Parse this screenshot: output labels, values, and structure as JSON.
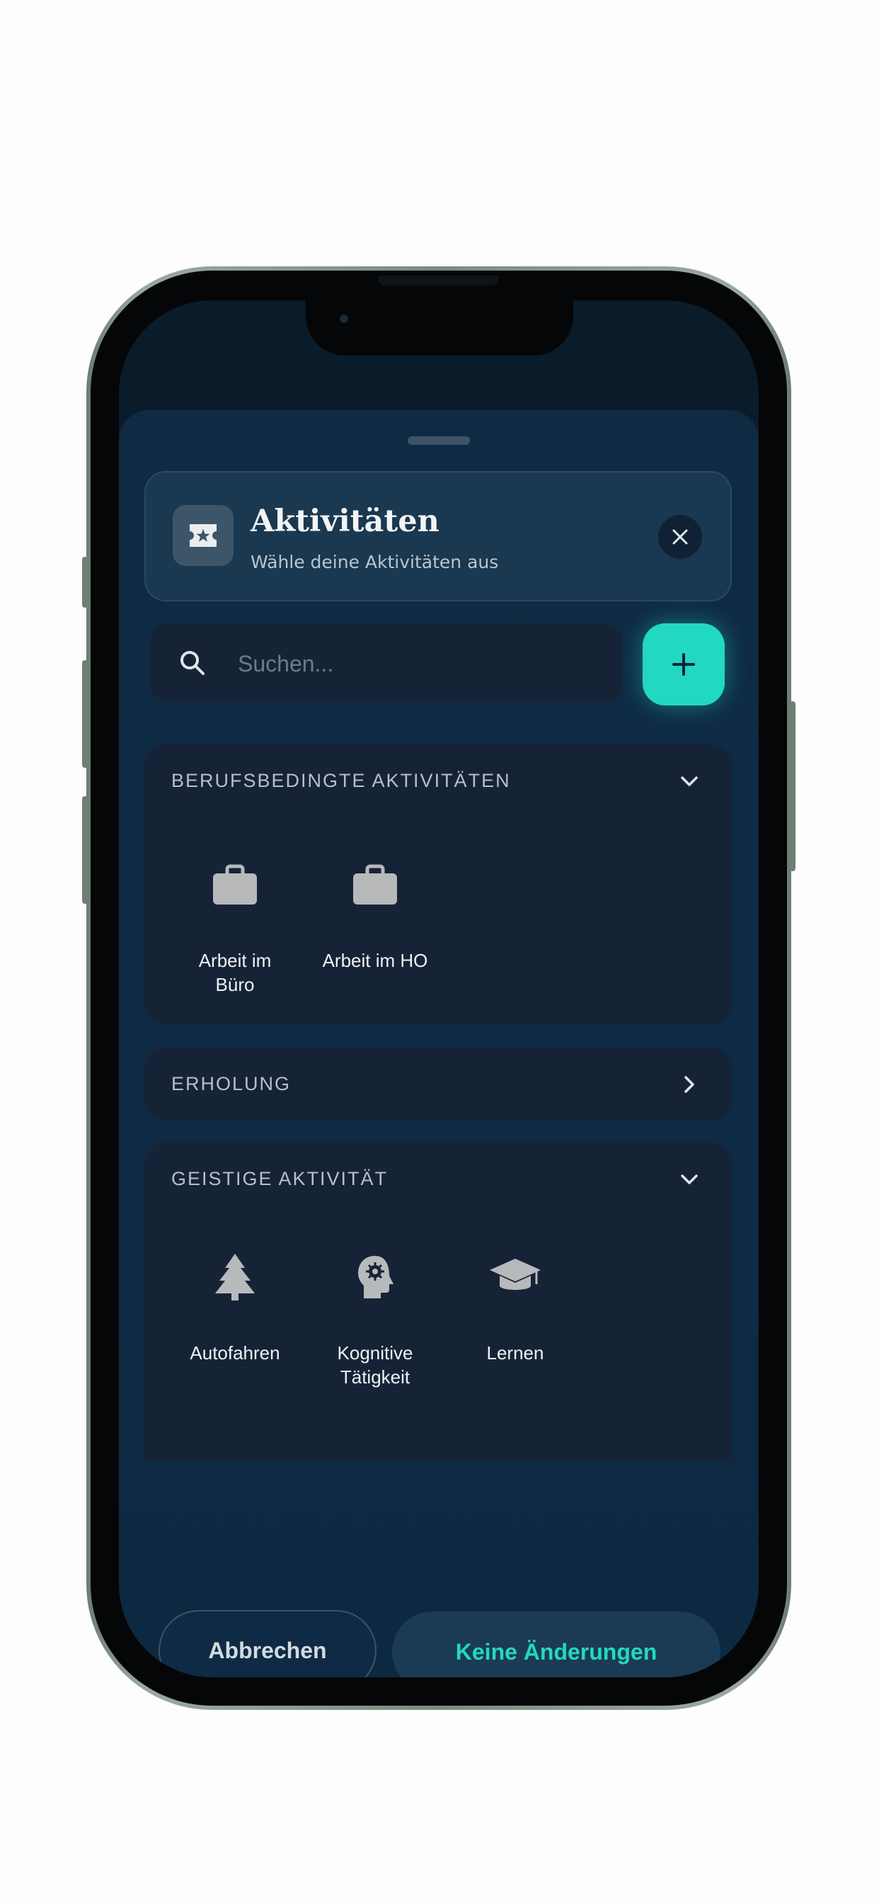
{
  "sheet": {
    "title": "Aktivitäten",
    "subtitle": "Wähle deine Aktivitäten aus",
    "header_icon": "ticket-star-icon",
    "close_icon": "close-icon"
  },
  "search": {
    "placeholder": "Suchen...",
    "value": "",
    "icon": "search-icon",
    "add_icon": "plus-icon"
  },
  "sections": [
    {
      "title": "BERUFSBEDINGTE AKTIVITÄTEN",
      "expanded": true,
      "chevron": "chevron-down-icon",
      "items": [
        {
          "label": "Arbeit im\nBüro",
          "icon": "briefcase-icon"
        },
        {
          "label": "Arbeit im HO",
          "icon": "briefcase-icon"
        }
      ]
    },
    {
      "title": "ERHOLUNG",
      "expanded": false,
      "chevron": "chevron-right-icon",
      "items": []
    },
    {
      "title": "GEISTIGE AKTIVITÄT",
      "expanded": true,
      "chevron": "chevron-down-icon",
      "items": [
        {
          "label": "Autofahren",
          "icon": "tree-icon"
        },
        {
          "label": "Kognitive\nTätigkeit",
          "icon": "head-gear-icon"
        },
        {
          "label": "Lernen",
          "icon": "graduation-cap-icon"
        }
      ]
    }
  ],
  "actions": {
    "cancel_label": "Abbrechen",
    "confirm_label": "Keine Änderungen"
  },
  "colors": {
    "accent": "#22d8c2",
    "sheet_background": "#0e2a44",
    "section_background": "#162337",
    "icon_gray": "#b7b9bb"
  }
}
